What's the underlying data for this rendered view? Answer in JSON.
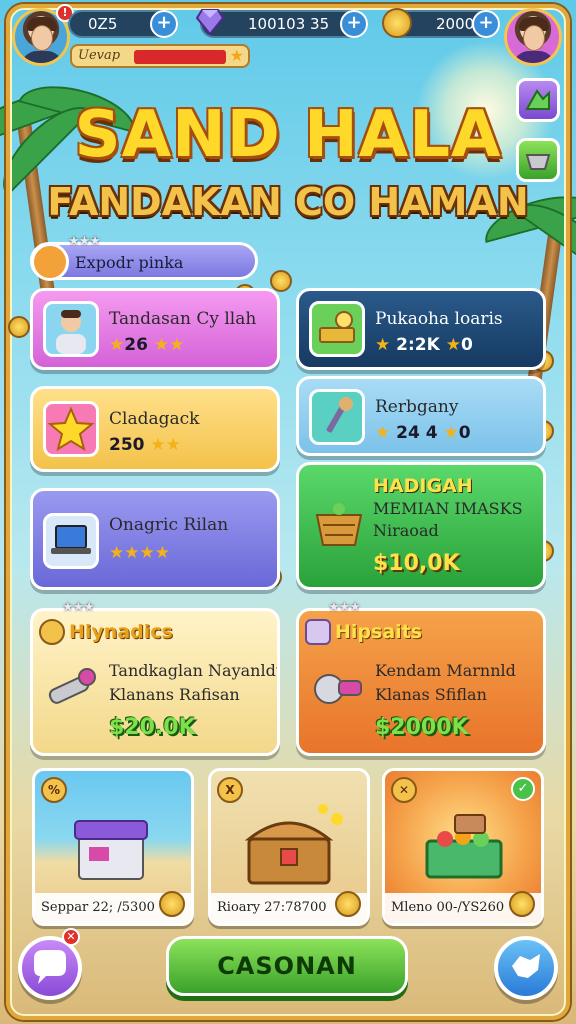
{
  "hud": {
    "resource1": "0Z5",
    "resource2": "100103 35",
    "resource3": "2000",
    "xp_label": "Uevap",
    "xp_progress": 0.55
  },
  "title": {
    "line1": "SAND HALA",
    "line2": "FANDAKAN CO HAMAN"
  },
  "category_pill": {
    "label": "Expodr pinka"
  },
  "cards": [
    {
      "name": "Tandasan Cy llah",
      "value": "26"
    },
    {
      "name": "Pukaoha loaris",
      "value": "2:2K",
      "suffix": "0"
    },
    {
      "name": "Cladagack",
      "value": "250"
    },
    {
      "name": "Rerbgany",
      "value": "24 4",
      "suffix": "0"
    },
    {
      "name": "Onagric Rilan"
    },
    {
      "heading": "HADIGAH",
      "name": "MEMIAN IMASKS",
      "sub": "Niraoad",
      "price": "$10,0K"
    }
  ],
  "offers": [
    {
      "title": "Hiynadics",
      "line1": "Tandkaglan Nayanldt",
      "line2": "Klanans Rafisan",
      "price": "$20.0K"
    },
    {
      "title": "Hipsaits",
      "line1": "Kendam Marnnld",
      "line2": "Klanas Sfiflan",
      "price": "$2000K"
    }
  ],
  "shop": [
    {
      "caption": "Seppar 22; /5300"
    },
    {
      "caption": "Rioary 27:78700"
    },
    {
      "caption": "Mleno 00-/YS260"
    }
  ],
  "cta": {
    "label": "CASONAN"
  },
  "colors": {
    "accent_gold": "#ffd92a",
    "cta_green": "#3aa22a"
  }
}
